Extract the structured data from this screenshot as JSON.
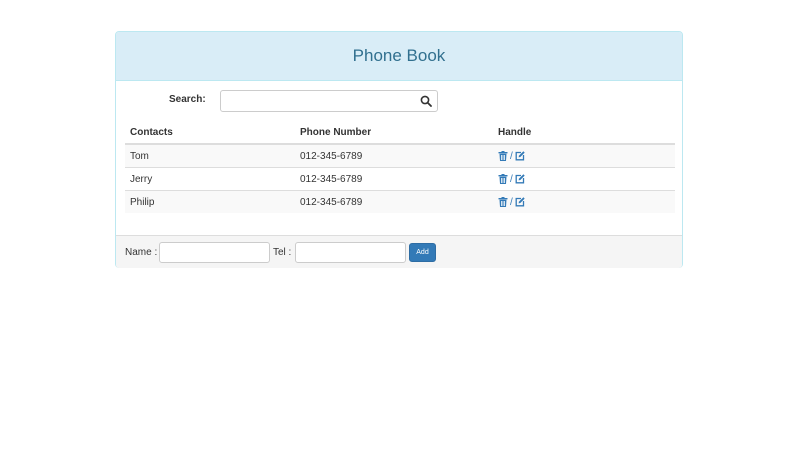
{
  "header": {
    "title": "Phone Book"
  },
  "search": {
    "label": "Search:",
    "value": "",
    "placeholder": ""
  },
  "table": {
    "headers": [
      "Contacts",
      "Phone Number",
      "Handle"
    ],
    "rows": [
      {
        "name": "Tom",
        "phone": "012-345-6789"
      },
      {
        "name": "Jerry",
        "phone": "012-345-6789"
      },
      {
        "name": "Philip",
        "phone": "012-345-6789"
      }
    ],
    "separator": "/"
  },
  "footer": {
    "name_label": "Name :",
    "tel_label": "Tel :",
    "name_value": "",
    "tel_value": "",
    "add_label": "Add"
  },
  "icons": {
    "search": "search-icon",
    "delete": "trash-icon",
    "edit": "edit-icon"
  },
  "colors": {
    "heading_bg": "#d9edf7",
    "heading_text": "#31708f",
    "accent": "#337ab7"
  }
}
